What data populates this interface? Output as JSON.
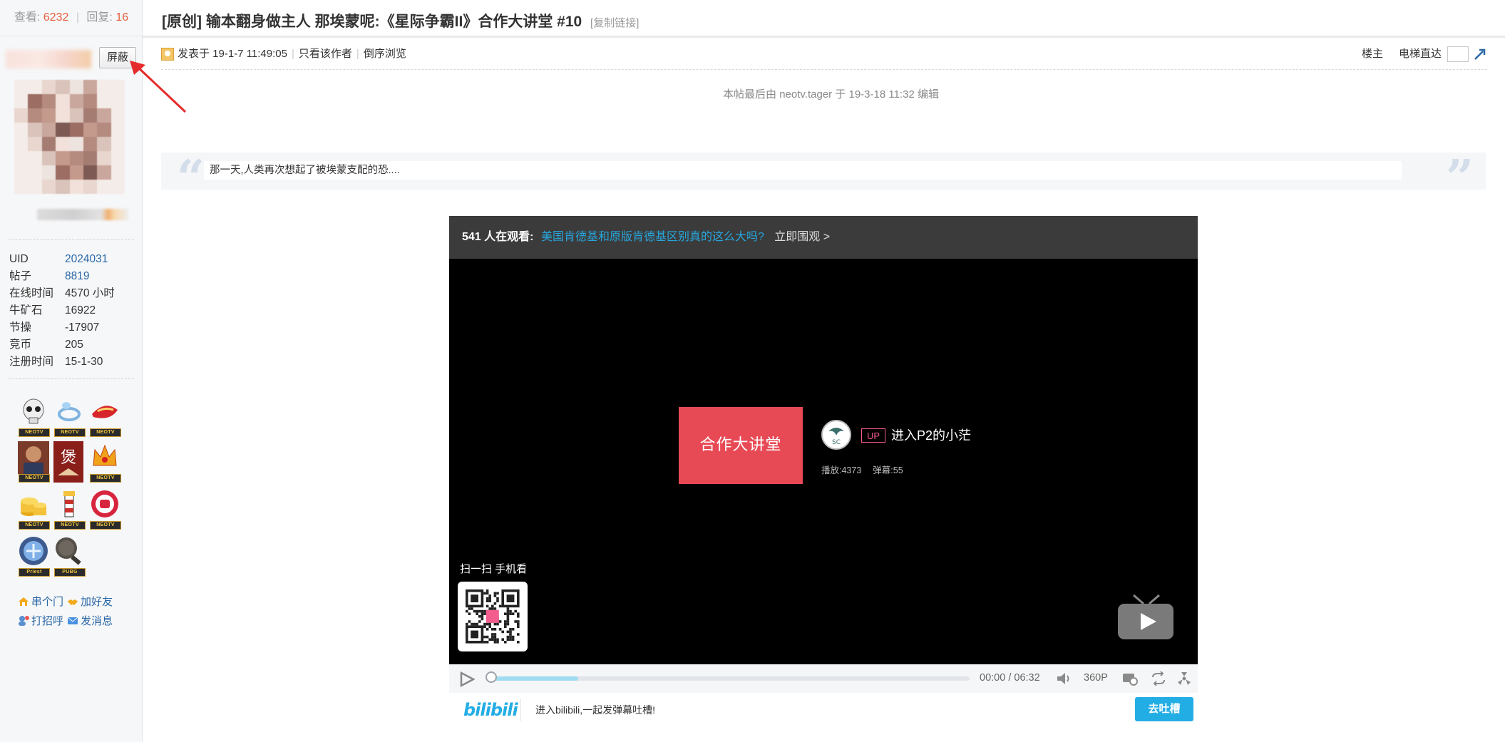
{
  "stats": {
    "views_label": "查看:",
    "views": "6232",
    "replies_label": "回复:",
    "replies": "16"
  },
  "title": {
    "text": "[原创] 输本翻身做主人 那埃蒙呢:《星际争霸II》合作大讲堂 #10",
    "copy_link": "[复制链接]"
  },
  "sidebar": {
    "block_button": "屏蔽",
    "info": [
      {
        "key": "UID",
        "value": "2024031"
      },
      {
        "key": "帖子",
        "value": "8819"
      },
      {
        "key": "在线时间",
        "value": "4570 小时"
      },
      {
        "key": "牛矿石",
        "value": "16922"
      },
      {
        "key": "节操",
        "value": "-17907"
      },
      {
        "key": "竞币",
        "value": "205"
      },
      {
        "key": "注册时间",
        "value": "15-1-30"
      }
    ],
    "medal_tag": "NEOTV",
    "medal_tag_priest": "Priest",
    "medal_tag_pubg": "PUBG",
    "actions": {
      "visit": "串个门",
      "add_friend": "加好友",
      "greet": "打招呼",
      "message": "发消息"
    }
  },
  "post": {
    "posted_at": "发表于 19-1-7 11:49:05",
    "only_author": "只看该作者",
    "reverse": "倒序浏览",
    "floor_label": "楼主",
    "elevator_label": "电梯直达",
    "edit_note": "本帖最后由 neotv.tager 于 19-3-18 11:32 编辑",
    "quote": "那一天,人类再次想起了被埃蒙支配的恐...."
  },
  "player": {
    "watching": "541 人在观看:",
    "video_link": "美国肯德基和原版肯德基区别真的这么大吗?",
    "go_watch": "立即围观 >",
    "cover_text": "合作大讲堂",
    "up_tag": "UP",
    "up_name": "进入P2的小茫",
    "plays": "播放:4373",
    "danmaku": "弹幕:55",
    "scan_text": "扫一扫 手机看",
    "time_current": "00:00",
    "time_sep": "/",
    "time_total": "06:32",
    "quality": "360P",
    "progress_buffered": 0.18,
    "bilibili": "bilibili",
    "danmu_placeholder": "进入bilibili,一起发弹幕吐槽!",
    "send_button": "去吐槽"
  },
  "colors": {
    "accent": "#23ade5",
    "link": "#2a67a6",
    "stat_num": "#e35d3c",
    "cover": "#e84a55"
  }
}
